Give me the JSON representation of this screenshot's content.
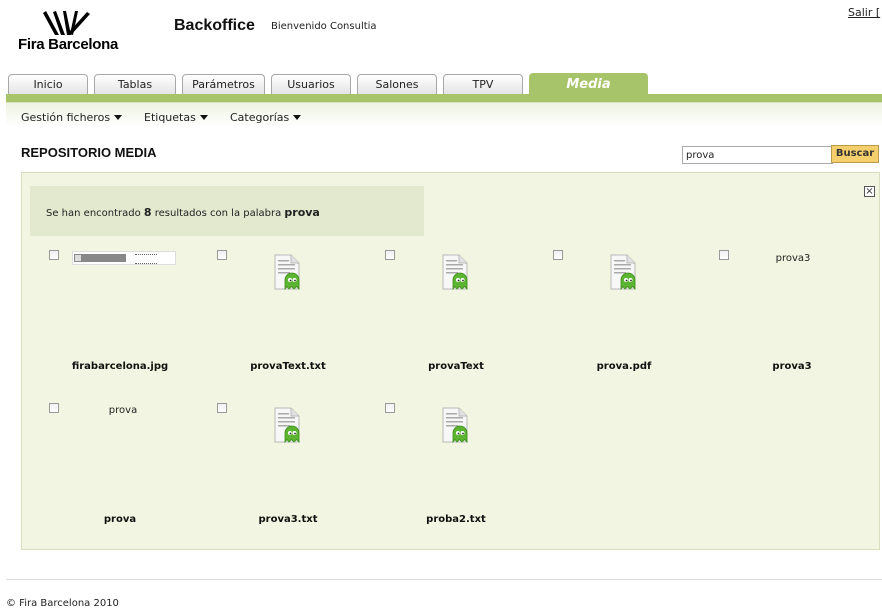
{
  "header": {
    "logo_text": "Fira Barcelona",
    "app_title": "Backoffice",
    "welcome": "Bienvenido Consultia",
    "logout": "Salir ["
  },
  "tabs": [
    {
      "label": "Inicio",
      "active": false
    },
    {
      "label": "Tablas maestras",
      "active": false
    },
    {
      "label": "Parámetros",
      "active": false
    },
    {
      "label": "Usuarios",
      "active": false
    },
    {
      "label": "Salones",
      "active": false
    },
    {
      "label": "TPV",
      "active": false
    },
    {
      "label": "Media",
      "active": true
    }
  ],
  "submenu": [
    {
      "label": "Gestión ficheros"
    },
    {
      "label": "Etiquetas"
    },
    {
      "label": "Categorías"
    }
  ],
  "page_title": "REPOSITORIO MEDIA",
  "search": {
    "value": "prova",
    "button": "Buscar"
  },
  "results": {
    "msg_prefix": "Se han encontrado ",
    "count": "8",
    "msg_middle": " resultados con la palabra ",
    "term": "prova",
    "close_symbol": "×"
  },
  "items": [
    {
      "name": "firabarcelona.jpg",
      "kind": "image-thumbnail"
    },
    {
      "name": "provaText.txt",
      "kind": "file-icon"
    },
    {
      "name": "provaText",
      "kind": "file-icon"
    },
    {
      "name": "prova.pdf",
      "kind": "file-icon"
    },
    {
      "name": "prova3",
      "kind": "text",
      "preview": "prova3"
    },
    {
      "name": "prova",
      "kind": "text",
      "preview": "prova"
    },
    {
      "name": "prova3.txt",
      "kind": "file-icon"
    },
    {
      "name": "proba2.txt",
      "kind": "file-icon"
    }
  ],
  "footer": {
    "copyright": "© Fira Barcelona 2010"
  },
  "colors": {
    "accent_green": "#a8c46a",
    "panel_bg": "#f2f5e1",
    "search_button": "#f5cf6b"
  }
}
